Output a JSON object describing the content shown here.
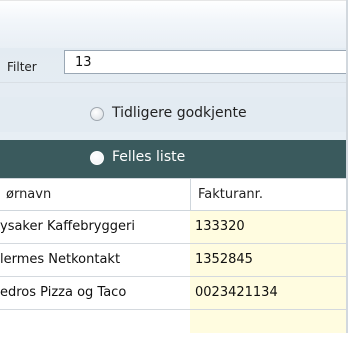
{
  "filter": {
    "label": "Filter",
    "value": "13"
  },
  "options": [
    {
      "label": "Tidligere godkjente",
      "selected": false
    },
    {
      "label": "Felles liste",
      "selected": true
    }
  ],
  "grid": {
    "columns": [
      "ørnavn",
      "Fakturanr."
    ],
    "rows": [
      {
        "name": "ysaker Kaffebryggeri",
        "invoice": "133320"
      },
      {
        "name": "lermes Netkontakt",
        "invoice": "1352845"
      },
      {
        "name": "edros Pizza og Taco",
        "invoice": "0023421134"
      }
    ]
  },
  "colors": {
    "selected_row": "#3a5a5d",
    "invoice_cell": "#fffce0"
  }
}
